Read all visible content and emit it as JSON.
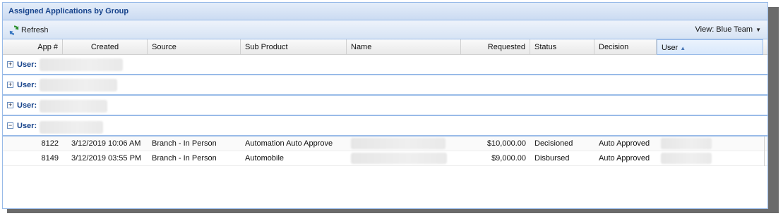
{
  "panel": {
    "title": "Assigned Applications by Group"
  },
  "toolbar": {
    "refresh_label": "Refresh",
    "view_label": "View: Blue Team"
  },
  "columns": {
    "app": "App #",
    "created": "Created",
    "source": "Source",
    "sub_product": "Sub Product",
    "name": "Name",
    "requested": "Requested",
    "status": "Status",
    "decision": "Decision",
    "user": "User"
  },
  "groups": [
    {
      "prefix": "User:",
      "toggle": "+",
      "expanded": false
    },
    {
      "prefix": "User:",
      "toggle": "+",
      "expanded": false
    },
    {
      "prefix": "User:",
      "toggle": "+",
      "expanded": false
    },
    {
      "prefix": "User:",
      "toggle": "−",
      "expanded": true
    }
  ],
  "rows": [
    {
      "app": "8122",
      "created": "3/12/2019 10:06 AM",
      "source": "Branch - In Person",
      "sub_product": "Automation Auto Approve",
      "requested": "$10,000.00",
      "status": "Decisioned",
      "decision": "Auto Approved"
    },
    {
      "app": "8149",
      "created": "3/12/2019 03:55 PM",
      "source": "Branch - In Person",
      "sub_product": "Automobile",
      "requested": "$9,000.00",
      "status": "Disbursed",
      "decision": "Auto Approved"
    }
  ],
  "colors": {
    "border": "#99bbe8",
    "title": "#15428b",
    "shadow": "#6b6b6b"
  },
  "icons": {
    "refresh": "refresh-icon",
    "expand": "plus-box-icon",
    "collapse": "minus-box-icon",
    "sort": "sort-ascending-icon",
    "view_caret": "caret-down-icon"
  }
}
